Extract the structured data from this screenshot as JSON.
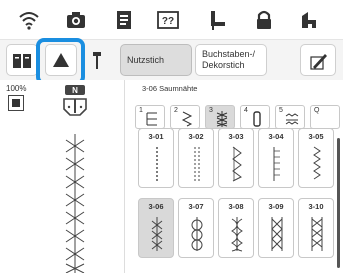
{
  "toolbar": {
    "utility_label": "Nutzstich",
    "letters_label": "Buchstaben-/ Dekorstich"
  },
  "left": {
    "width_percent": "100%",
    "presser_foot_letter": "N"
  },
  "grid": {
    "header": "3-06  Saumnähte",
    "categories": [
      {
        "num": "1",
        "icon": "straight-stitch-icon"
      },
      {
        "num": "2",
        "icon": "zigzag-stitch-icon"
      },
      {
        "num": "3",
        "icon": "hem-stitch-icon",
        "selected": true
      },
      {
        "num": "4",
        "icon": "buttonhole-icon"
      },
      {
        "num": "5",
        "icon": "decorative-stitch-icon"
      },
      {
        "num": "Q",
        "icon": "quilt-stitch-icon"
      }
    ],
    "tiles": [
      {
        "label": "3-01"
      },
      {
        "label": "3-02"
      },
      {
        "label": "3-03"
      },
      {
        "label": "3-04"
      },
      {
        "label": "3-05"
      },
      {
        "label": "3-06",
        "selected": true
      },
      {
        "label": "3-07"
      },
      {
        "label": "3-08"
      },
      {
        "label": "3-09"
      },
      {
        "label": "3-10"
      }
    ]
  },
  "colors": {
    "highlight": "#1a8ee0",
    "icon": "#333333",
    "selected": "#d9d9d9"
  }
}
